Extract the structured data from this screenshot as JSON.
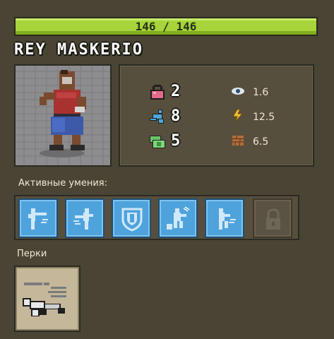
{
  "hp": {
    "current": 146,
    "max": 146,
    "text": "146 / 146",
    "fraction": 1.0,
    "color": "#a7d43a"
  },
  "character": {
    "name": "REY MASKERIO"
  },
  "stats": {
    "strength": {
      "icon": "kettlebell-icon",
      "value": "2"
    },
    "agility": {
      "icon": "running-figure-icon",
      "value": "8"
    },
    "endurance": {
      "icon": "cash-stack-icon",
      "value": "5"
    },
    "perception": {
      "icon": "eye-icon",
      "value": "1.6"
    },
    "power": {
      "icon": "lightning-fist-icon",
      "value": "12.5"
    },
    "defense": {
      "icon": "brick-wall-icon",
      "value": "6.5"
    }
  },
  "skills": {
    "label": "Активные умения:",
    "items": [
      {
        "icon": "high-kick-icon",
        "locked": false
      },
      {
        "icon": "side-kick-icon",
        "locked": false
      },
      {
        "icon": "shield-icon",
        "locked": false
      },
      {
        "icon": "ground-punch-icon",
        "locked": false
      },
      {
        "icon": "dodge-icon",
        "locked": false
      },
      {
        "icon": "lock-icon",
        "locked": true
      }
    ],
    "color_active": "#4fa3dc"
  },
  "perks": {
    "label": "Перки",
    "items": [
      {
        "icon": "knockdown-perk-icon"
      }
    ]
  }
}
